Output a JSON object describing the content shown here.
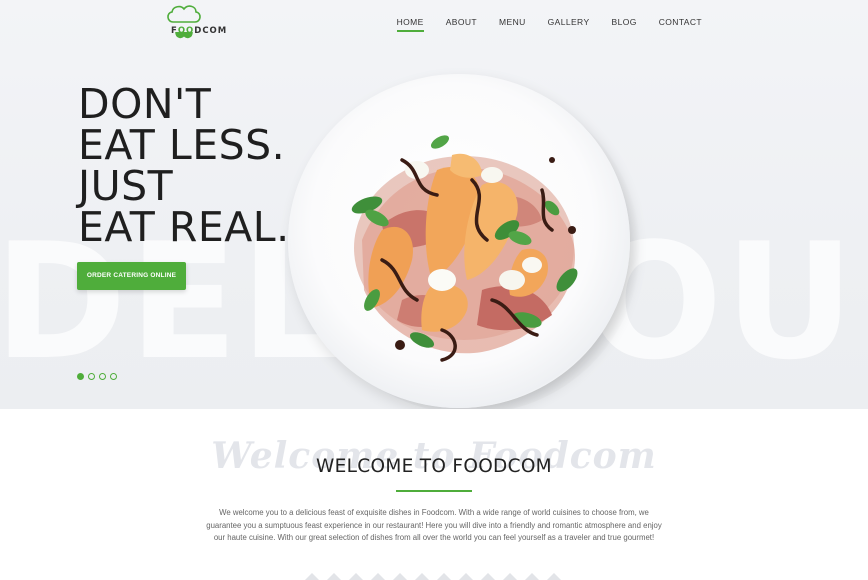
{
  "header": {
    "logo_prefix": "F",
    "logo_accent": "OO",
    "logo_suffix": "DCOM",
    "nav": [
      {
        "label": "HOME",
        "active": true
      },
      {
        "label": "ABOUT",
        "active": false
      },
      {
        "label": "MENU",
        "active": false
      },
      {
        "label": "GALLERY",
        "active": false
      },
      {
        "label": "BLOG",
        "active": false
      },
      {
        "label": "CONTACT",
        "active": false
      }
    ]
  },
  "hero": {
    "headline": [
      "DON'T",
      "EAT LESS.",
      "JUST",
      "EAT REAL."
    ],
    "background_word": "DELICIOUS",
    "cta_label": "ORDER CATERING ONLINE",
    "slides_total": 4,
    "slides_active": 1
  },
  "welcome": {
    "script_text": "Welcome to Foodcom",
    "title": "WELCOME TO FOODCOM",
    "body": "We welcome you to a delicious feast of exquisite dishes in Foodcom. With a wide range of world cuisines to choose from, we guarantee you a sumptuous feast experience in our restaurant!  Here you will dive into a friendly and romantic atmosphere and enjoy our haute cuisine. With our great selection of dishes from all over the world you can feel yourself as a traveler and true gourmet!"
  },
  "colors": {
    "accent": "#4fad3b",
    "text_dark": "#1f1f1f",
    "hero_bg": "#eef0f3"
  },
  "icons": [
    "chef-hat-logo-icon",
    "slider-dot-icon",
    "zigzag-divider-icon"
  ]
}
